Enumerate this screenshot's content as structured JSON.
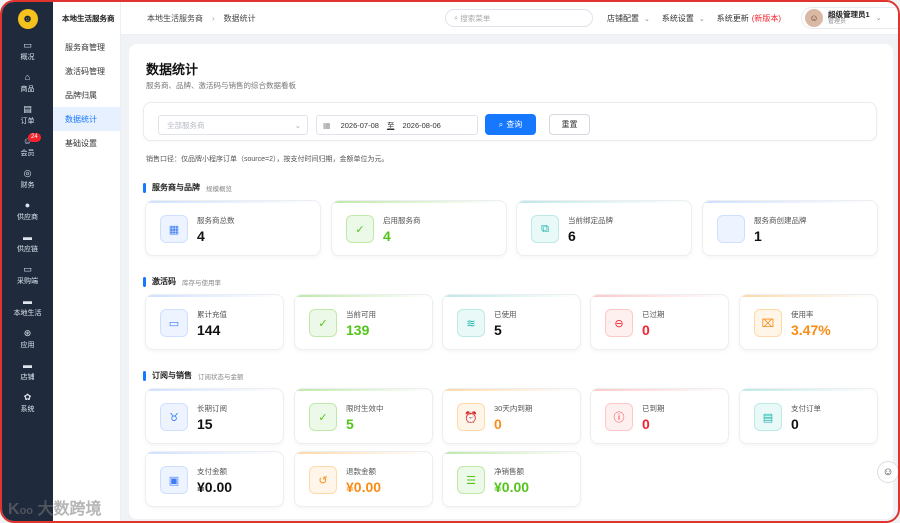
{
  "app": {
    "logo_icon": "smiley-logo-icon",
    "brand_color": "#1677ff"
  },
  "left_nav": [
    {
      "icon": "monitor-icon",
      "glyph": "▭",
      "label": "概况"
    },
    {
      "icon": "home-icon",
      "glyph": "⌂",
      "label": "商品"
    },
    {
      "icon": "document-icon",
      "glyph": "▤",
      "label": "订单"
    },
    {
      "icon": "user-group-icon",
      "glyph": "☺",
      "label": "会员",
      "badge": "24"
    },
    {
      "icon": "wallet-icon",
      "glyph": "◎",
      "label": "财务"
    },
    {
      "icon": "person-icon",
      "glyph": "●",
      "label": "供应商"
    },
    {
      "icon": "truck-icon",
      "glyph": "▬",
      "label": "供应链"
    },
    {
      "icon": "cart-icon",
      "glyph": "▭",
      "label": "采购端"
    },
    {
      "icon": "layers-icon",
      "glyph": "▬",
      "label": "本地生活"
    },
    {
      "icon": "apps-icon",
      "glyph": "⊛",
      "label": "应用"
    },
    {
      "icon": "store-icon",
      "glyph": "▬",
      "label": "店铺"
    },
    {
      "icon": "gear-icon",
      "glyph": "✿",
      "label": "系统"
    }
  ],
  "sub_nav": {
    "title": "本地生活服务商",
    "items": [
      "服务商管理",
      "激活码管理",
      "品牌归属",
      "数据统计",
      "基础设置"
    ],
    "active": "数据统计"
  },
  "topbar": {
    "breadcrumb": [
      "本地生活服务商",
      "数据统计"
    ],
    "search_placeholder": "搜索菜单",
    "menus": [
      "店铺配置",
      "系统设置"
    ],
    "update_label": "系统更新",
    "update_badge": "(新版本)",
    "user_name": "超级管理员1",
    "user_role": "管理员"
  },
  "page": {
    "title": "数据统计",
    "subtitle": "服务商、品牌、激活码与销售的综合数据看板",
    "filter": {
      "provider_placeholder": "全部服务商",
      "date_start": "2026-07-08",
      "date_sep": "至",
      "date_end": "2026-08-06",
      "query_label": "查询",
      "reset_label": "重置"
    },
    "note": "销售口径：仅品牌小程序订单（source=2），按支付时间归期，金额单位为元。"
  },
  "sections": [
    {
      "title": "服务商与品牌",
      "subtitle": "规模概览",
      "cards": [
        {
          "label": "服务商总数",
          "value": "4",
          "icon": "building-icon",
          "glyph": "▦",
          "tone": "blue"
        },
        {
          "label": "启用服务商",
          "value": "4",
          "icon": "check-circle-icon",
          "glyph": "✓",
          "tone": "green"
        },
        {
          "label": "当前绑定品牌",
          "value": "6",
          "icon": "link-icon",
          "glyph": "⧉",
          "tone": "cyan"
        },
        {
          "label": "服务商创建品牌",
          "value": "1",
          "icon": "blank-icon",
          "glyph": "",
          "tone": "blue"
        }
      ]
    },
    {
      "title": "激活码",
      "subtitle": "库存与使用率",
      "cards": [
        {
          "label": "累计充值",
          "value": "144",
          "icon": "inbox-icon",
          "glyph": "▭",
          "tone": "blue"
        },
        {
          "label": "当前可用",
          "value": "139",
          "icon": "check-circle-icon",
          "glyph": "✓",
          "tone": "green"
        },
        {
          "label": "已使用",
          "value": "5",
          "icon": "checklist-icon",
          "glyph": "≋",
          "tone": "cyan"
        },
        {
          "label": "已过期",
          "value": "0",
          "icon": "minus-circle-icon",
          "glyph": "⊖",
          "tone": "red"
        },
        {
          "label": "使用率",
          "value": "3.47%",
          "icon": "chart-board-icon",
          "glyph": "⌧",
          "tone": "orange"
        }
      ]
    },
    {
      "title": "订阅与销售",
      "subtitle": "订阅状态与金额",
      "cards": [
        {
          "label": "长期订阅",
          "value": "15",
          "icon": "medal-icon",
          "glyph": "♉",
          "tone": "blue"
        },
        {
          "label": "限时生效中",
          "value": "5",
          "icon": "check-circle-icon",
          "glyph": "✓",
          "tone": "green"
        },
        {
          "label": "30天内到期",
          "value": "0",
          "icon": "alarm-clock-icon",
          "glyph": "⏰",
          "tone": "orange"
        },
        {
          "label": "已到期",
          "value": "0",
          "icon": "alert-circle-icon",
          "glyph": "ⓘ",
          "tone": "red"
        },
        {
          "label": "支付订单",
          "value": "0",
          "icon": "receipt-icon",
          "glyph": "▤",
          "tone": "cyan"
        },
        {
          "label": "支付金额",
          "value": "¥0.00",
          "icon": "wallet-icon",
          "glyph": "▣",
          "tone": "blue"
        },
        {
          "label": "退款金额",
          "value": "¥0.00",
          "icon": "refund-icon",
          "glyph": "↺",
          "tone": "orange"
        },
        {
          "label": "净销售额",
          "value": "¥0.00",
          "icon": "coins-stack-icon",
          "glyph": "☰",
          "tone": "green"
        }
      ]
    }
  ],
  "tones": {
    "blue": {
      "bg": "#eef4ff",
      "fg": "#3f7cf5",
      "line": "#cfe0ff",
      "value": "#111111"
    },
    "green": {
      "bg": "#edf9e8",
      "fg": "#52c41a",
      "line": "#bfe9a8",
      "value": "#52c41a"
    },
    "cyan": {
      "bg": "#e8f9f8",
      "fg": "#19b3a8",
      "line": "#bde9e6",
      "value": "#111111"
    },
    "red": {
      "bg": "#fff0f0",
      "fg": "#f5222d",
      "line": "#ffc8c8",
      "value": "#f5222d"
    },
    "orange": {
      "bg": "#fff5e8",
      "fg": "#fa8c16",
      "line": "#ffd9a8",
      "value": "#fa8c16"
    }
  },
  "watermark": "大数跨境"
}
